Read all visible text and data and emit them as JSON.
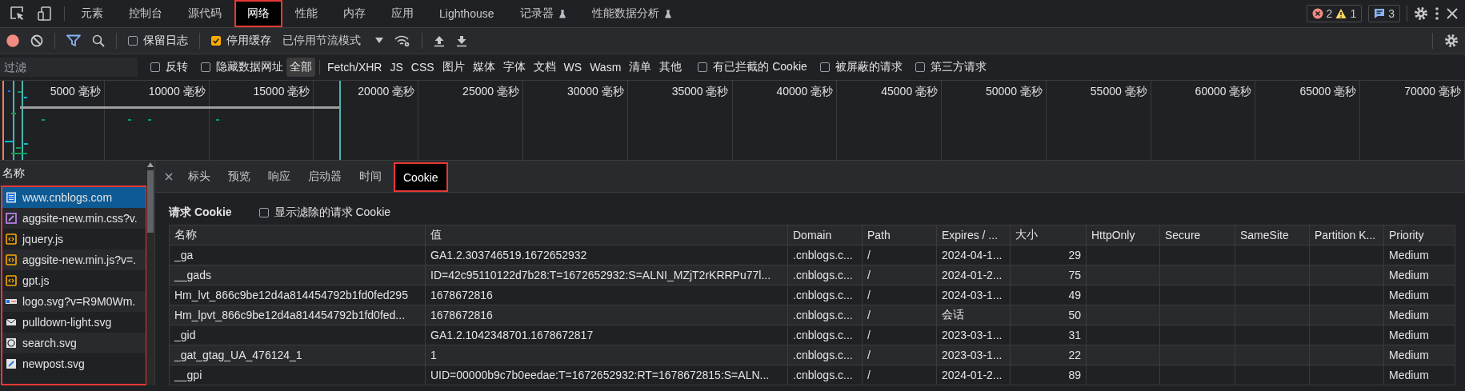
{
  "main_tabs": [
    {
      "label": "元素",
      "selected": false,
      "highlighted": false,
      "experimental": false
    },
    {
      "label": "控制台",
      "selected": false,
      "highlighted": false,
      "experimental": false
    },
    {
      "label": "源代码",
      "selected": false,
      "highlighted": false,
      "experimental": false
    },
    {
      "label": "网络",
      "selected": true,
      "highlighted": true,
      "experimental": false
    },
    {
      "label": "性能",
      "selected": false,
      "highlighted": false,
      "experimental": false
    },
    {
      "label": "内存",
      "selected": false,
      "highlighted": false,
      "experimental": false
    },
    {
      "label": "应用",
      "selected": false,
      "highlighted": false,
      "experimental": false
    },
    {
      "label": "Lighthouse",
      "selected": false,
      "highlighted": false,
      "experimental": false
    },
    {
      "label": "记录器",
      "selected": false,
      "highlighted": false,
      "experimental": true
    },
    {
      "label": "性能数据分析",
      "selected": false,
      "highlighted": false,
      "experimental": true
    }
  ],
  "issue_counters": {
    "errors": "2",
    "warnings": "1",
    "messages": "3"
  },
  "toolbar": {
    "recording": true,
    "preserve_log": {
      "label": "保留日志",
      "checked": false
    },
    "disable_cache": {
      "label": "停用缓存",
      "checked": true
    },
    "throttling": "已停用节流模式"
  },
  "filter": {
    "placeholder": "过滤",
    "invert": {
      "label": "反转",
      "checked": false
    },
    "hide_data_urls": {
      "label": "隐藏数据网址",
      "checked": false
    },
    "types": [
      {
        "label": "全部",
        "selected": true
      },
      {
        "label": "Fetch/XHR",
        "selected": false
      },
      {
        "label": "JS",
        "selected": false
      },
      {
        "label": "CSS",
        "selected": false
      },
      {
        "label": "图片",
        "selected": false
      },
      {
        "label": "媒体",
        "selected": false
      },
      {
        "label": "字体",
        "selected": false
      },
      {
        "label": "文档",
        "selected": false
      },
      {
        "label": "WS",
        "selected": false
      },
      {
        "label": "Wasm",
        "selected": false
      },
      {
        "label": "清单",
        "selected": false
      },
      {
        "label": "其他",
        "selected": false
      }
    ],
    "options": [
      {
        "label": "有已拦截的 Cookie",
        "checked": false
      },
      {
        "label": "被屏蔽的请求",
        "checked": false
      },
      {
        "label": "第三方请求",
        "checked": false
      }
    ]
  },
  "overview": {
    "ticks": [
      "5000 毫秒",
      "10000 毫秒",
      "15000 毫秒",
      "20000 毫秒",
      "25000 毫秒",
      "30000 毫秒",
      "35000 毫秒",
      "40000 毫秒",
      "45000 毫秒",
      "50000 毫秒",
      "55000 毫秒",
      "60000 毫秒",
      "65000 毫秒",
      "70000 毫秒"
    ]
  },
  "requests": {
    "header": "名称",
    "highlighted": true,
    "items": [
      {
        "name": "www.cnblogs.com",
        "kind": "document",
        "selected": true
      },
      {
        "name": "aggsite-new.min.css?v.",
        "kind": "stylesheet",
        "selected": false
      },
      {
        "name": "jquery.js",
        "kind": "script",
        "selected": false
      },
      {
        "name": "aggsite-new.min.js?v=.",
        "kind": "script",
        "selected": false
      },
      {
        "name": "gpt.js",
        "kind": "script",
        "selected": false
      },
      {
        "name": "logo.svg?v=R9M0Wm.",
        "kind": "image",
        "selected": false
      },
      {
        "name": "pulldown-light.svg",
        "kind": "envelope",
        "selected": false
      },
      {
        "name": "search.svg",
        "kind": "magnifier",
        "selected": false
      },
      {
        "name": "newpost.svg",
        "kind": "pencil",
        "selected": false
      }
    ]
  },
  "details": {
    "tabs": [
      {
        "label": "标头",
        "selected": false,
        "highlighted": false
      },
      {
        "label": "预览",
        "selected": false,
        "highlighted": false
      },
      {
        "label": "响应",
        "selected": false,
        "highlighted": false
      },
      {
        "label": "启动器",
        "selected": false,
        "highlighted": false
      },
      {
        "label": "时间",
        "selected": false,
        "highlighted": false
      },
      {
        "label": "Cookie",
        "selected": true,
        "highlighted": true
      }
    ],
    "section_title": "请求 Cookie",
    "show_filtered": {
      "label": "显示滤除的请求 Cookie",
      "checked": false
    },
    "table": {
      "columns": [
        "名称",
        "值",
        "Domain",
        "Path",
        "Expires / ...",
        "大小",
        "HttpOnly",
        "Secure",
        "SameSite",
        "Partition K...",
        "Priority"
      ],
      "rows": [
        [
          "_ga",
          "GA1.2.303746519.1672652932",
          ".cnblogs.c...",
          "/",
          "2024-04-1...",
          "29",
          "",
          "",
          "",
          "",
          "Medium"
        ],
        [
          "__gads",
          "ID=42c95110122d7b28:T=1672652932:S=ALNI_MZjT2rKRRPu77l...",
          ".cnblogs.c...",
          "/",
          "2024-01-2...",
          "75",
          "",
          "",
          "",
          "",
          "Medium"
        ],
        [
          "Hm_lvt_866c9be12d4a814454792b1fd0fed295",
          "1678672816",
          ".cnblogs.c...",
          "/",
          "2024-03-1...",
          "49",
          "",
          "",
          "",
          "",
          "Medium"
        ],
        [
          "Hm_lpvt_866c9be12d4a814454792b1fd0fed...",
          "1678672816",
          ".cnblogs.c...",
          "/",
          "会话",
          "50",
          "",
          "",
          "",
          "",
          "Medium"
        ],
        [
          "_gid",
          "GA1.2.1042348701.1678672817",
          ".cnblogs.c...",
          "/",
          "2023-03-1...",
          "31",
          "",
          "",
          "",
          "",
          "Medium"
        ],
        [
          "_gat_gtag_UA_476124_1",
          "1",
          ".cnblogs.c...",
          "/",
          "2023-03-1...",
          "22",
          "",
          "",
          "",
          "",
          "Medium"
        ],
        [
          "__gpi",
          "UID=00000b9c7b0eedae:T=1672652932:RT=1678672815:S=ALN...",
          ".cnblogs.c...",
          "/",
          "2024-01-2...",
          "89",
          "",
          "",
          "",
          "",
          "Medium"
        ]
      ]
    }
  }
}
